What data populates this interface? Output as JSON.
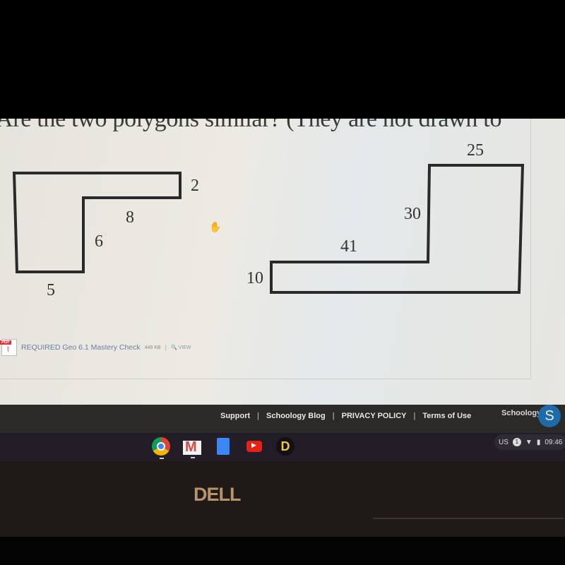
{
  "question": {
    "text": "Are the two polygons similar? (They are not drawn to"
  },
  "polygon_a": {
    "labels": {
      "right_side": "2",
      "inner_top": "8",
      "inner_side": "6",
      "bottom": "5"
    }
  },
  "polygon_b": {
    "labels": {
      "top": "25",
      "inner_side": "30",
      "inner_top": "41",
      "left_side": "10"
    }
  },
  "attachment": {
    "badge": "PDF",
    "name": "REQUIRED Geo 6.1 Mastery Check",
    "size": "449 KB",
    "separator": "|",
    "view_label": "VIEW"
  },
  "footer": {
    "links": [
      "Support",
      "Schoology Blog",
      "PRIVACY POLICY",
      "Terms of Use"
    ],
    "separator": "|",
    "brand": "Schoology",
    "brand_logo": "S"
  },
  "shelf": {
    "apps": [
      "chrome",
      "gmail",
      "docs",
      "youtube",
      "d-app"
    ],
    "d_app_letter": "D",
    "tray": {
      "input_method": "US",
      "notification_count": "1",
      "time": "09:46"
    }
  },
  "bezel": {
    "logo": "DELL"
  },
  "colors": {
    "footer_bg": "#2b2a29",
    "brand_blue": "#1f6aa8",
    "dell_logo": "#b89468",
    "pdf_red": "#d33333"
  }
}
